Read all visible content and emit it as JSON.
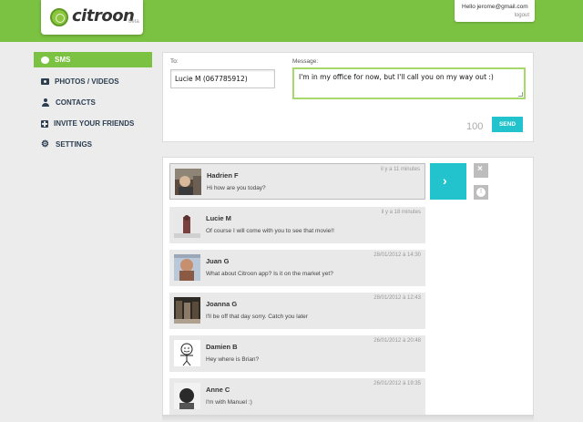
{
  "header": {
    "logo_text": "citroon",
    "logo_beta": "beta",
    "hello_text": "Hello jerome@gmail.com",
    "logout_label": "logout"
  },
  "sidebar": {
    "items": [
      {
        "label": "SMS",
        "icon": "sms-bubble-icon",
        "active": true
      },
      {
        "label": "PHOTOS / VIDEOS",
        "icon": "camera-icon",
        "active": false
      },
      {
        "label": "CONTACTS",
        "icon": "contact-icon",
        "active": false
      },
      {
        "label": "INVITE YOUR FRIENDS",
        "icon": "plus-icon",
        "active": false
      },
      {
        "label": "SETTINGS",
        "icon": "gear-icon",
        "active": false
      }
    ]
  },
  "compose": {
    "to_label": "To:",
    "to_value": "Lucie M (067785912)",
    "message_label": "Message:",
    "message_value": "I'm in my office for now, but I'll call you on my way out :)",
    "char_count": "100",
    "send_label": "SEND"
  },
  "conversations": [
    {
      "name": "Hadrien F",
      "text": "Hi how are you today?",
      "time": "il y a 11 minutes",
      "selected": true
    },
    {
      "name": "Lucie M",
      "text": "Of course I will come with you to see that movie!!",
      "time": "il y a 18 minutes",
      "selected": false
    },
    {
      "name": "Juan G",
      "text": "What about Citroon app? Is it on the market yet?",
      "time": "28/01/2012 à 14:30",
      "selected": false
    },
    {
      "name": "Joanna G",
      "text": "I'll be off that day sorry. Catch you later",
      "time": "28/01/2012 à 12:43",
      "selected": false
    },
    {
      "name": "Damien B",
      "text": "Hey where is Brian?",
      "time": "26/01/2012 à 20:48",
      "selected": false
    },
    {
      "name": "Anne C",
      "text": "I'm with Manuel :)",
      "time": "26/01/2012 à 19:35",
      "selected": false
    }
  ],
  "actions": {
    "open_icon": "chevron-right-icon",
    "delete_icon": "close-icon",
    "info_icon": "info-icon"
  },
  "colors": {
    "brand_green": "#7bc142",
    "accent_cyan": "#22c3cc"
  }
}
